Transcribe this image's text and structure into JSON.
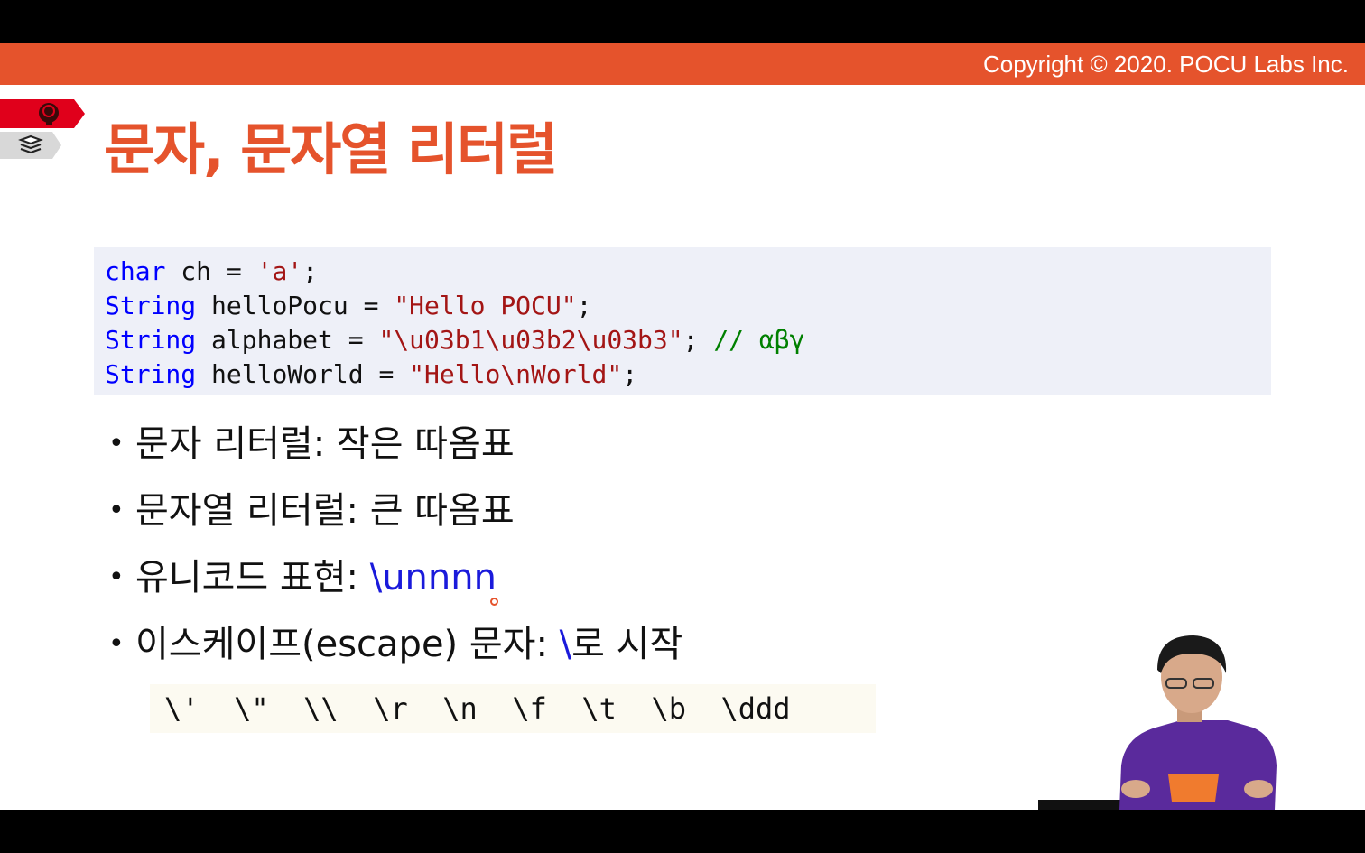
{
  "header": {
    "copyright": "Copyright © 2020. POCU Labs Inc."
  },
  "slide": {
    "title": "문자, 문자열 리터럴",
    "code": {
      "lines": [
        [
          {
            "t": "char",
            "c": "kw"
          },
          {
            "t": " ch = ",
            "c": "plain"
          },
          {
            "t": "'a'",
            "c": "str"
          },
          {
            "t": ";",
            "c": "plain"
          }
        ],
        [
          {
            "t": "String",
            "c": "kw"
          },
          {
            "t": " helloPocu = ",
            "c": "plain"
          },
          {
            "t": "\"Hello POCU\"",
            "c": "str"
          },
          {
            "t": ";",
            "c": "plain"
          }
        ],
        [
          {
            "t": "String",
            "c": "kw"
          },
          {
            "t": " alphabet = ",
            "c": "plain"
          },
          {
            "t": "\"\\u03b1\\u03b2\\u03b3\"",
            "c": "str"
          },
          {
            "t": "; ",
            "c": "plain"
          },
          {
            "t": "// αβγ",
            "c": "cmt"
          }
        ],
        [
          {
            "t": "String",
            "c": "kw"
          },
          {
            "t": " helloWorld = ",
            "c": "plain"
          },
          {
            "t": "\"Hello\\nWorld\"",
            "c": "str"
          },
          {
            "t": ";",
            "c": "plain"
          }
        ]
      ]
    },
    "bullets": [
      {
        "text": "문자 리터럴: 작은 따옴표",
        "highlight": "",
        "suffix": ""
      },
      {
        "text": "문자열 리터럴: 큰 따옴표",
        "highlight": "",
        "suffix": ""
      },
      {
        "text": "유니코드 표현: ",
        "highlight": "\\unnnn",
        "suffix": ""
      },
      {
        "text": "이스케이프(escape) 문자: ",
        "highlight": "\\",
        "suffix": "로 시작"
      }
    ],
    "escape_sequences": "\\'  \\\"  \\\\  \\r  \\n  \\f  \\t  \\b  \\ddd"
  },
  "icons": {
    "tag_red": "brain-head-icon",
    "tag_grey": "book-stack-icon"
  },
  "colors": {
    "accent": "#e5532c",
    "keyword": "#0000ff",
    "string": "#a31515",
    "comment": "#008000",
    "highlight": "#1a1adb"
  }
}
